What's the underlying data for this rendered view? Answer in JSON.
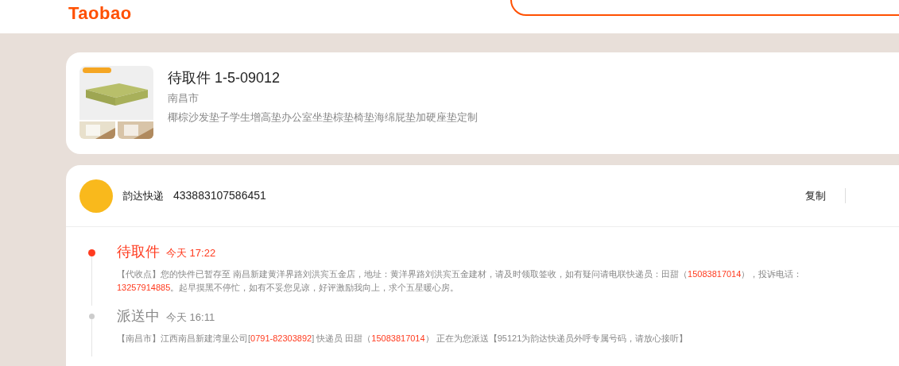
{
  "header": {
    "logo": "Taobao"
  },
  "package": {
    "title": "待取件 1-5-09012",
    "city": "南昌市",
    "product": "椰棕沙发垫子学生增高垫办公室坐垫棕垫椅垫海绵屁垫加硬座垫定制"
  },
  "courier": {
    "name": "韵达快递",
    "tracking_number": "433883107586451",
    "copy_button": "复制"
  },
  "events": [
    {
      "status": "待取件",
      "time": "今天 17:22",
      "current": true,
      "detail": [
        {
          "text": "【代收点】您的快件已暂存至 南昌新建黄洋界路刘洪宾五金店，地址：黄洋界路刘洪宾五金建材，请及时领取签收，如有疑问请电联快递员：田甜（",
          "highlight": false
        },
        {
          "text": "15083817014",
          "highlight": true
        },
        {
          "text": "），投诉电话：",
          "highlight": false
        },
        {
          "text": "13257914885",
          "highlight": true
        },
        {
          "text": "。起早摸黑不停忙，如有不妥您见谅，好评激励我向上，求个五星暖心房。",
          "highlight": false
        }
      ]
    },
    {
      "status": "派送中",
      "time": "今天 16:11",
      "current": false,
      "detail": [
        {
          "text": "【南昌市】江西南昌新建湾里公司[",
          "highlight": false
        },
        {
          "text": "0791-82303892",
          "highlight": true
        },
        {
          "text": "] 快递员 田甜（",
          "highlight": false
        },
        {
          "text": "15083817014",
          "highlight": true
        },
        {
          "text": "） 正在为您派送【95121为韵达快递员外呼专属号码，请放心接听】",
          "highlight": false
        }
      ]
    }
  ]
}
